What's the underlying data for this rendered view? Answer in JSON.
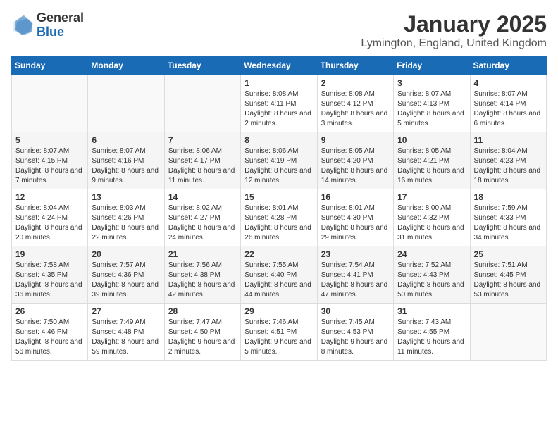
{
  "logo": {
    "general": "General",
    "blue": "Blue"
  },
  "title": "January 2025",
  "location": "Lymington, England, United Kingdom",
  "weekdays": [
    "Sunday",
    "Monday",
    "Tuesday",
    "Wednesday",
    "Thursday",
    "Friday",
    "Saturday"
  ],
  "weeks": [
    [
      {
        "day": "",
        "info": ""
      },
      {
        "day": "",
        "info": ""
      },
      {
        "day": "",
        "info": ""
      },
      {
        "day": "1",
        "info": "Sunrise: 8:08 AM\nSunset: 4:11 PM\nDaylight: 8 hours and 2 minutes."
      },
      {
        "day": "2",
        "info": "Sunrise: 8:08 AM\nSunset: 4:12 PM\nDaylight: 8 hours and 3 minutes."
      },
      {
        "day": "3",
        "info": "Sunrise: 8:07 AM\nSunset: 4:13 PM\nDaylight: 8 hours and 5 minutes."
      },
      {
        "day": "4",
        "info": "Sunrise: 8:07 AM\nSunset: 4:14 PM\nDaylight: 8 hours and 6 minutes."
      }
    ],
    [
      {
        "day": "5",
        "info": "Sunrise: 8:07 AM\nSunset: 4:15 PM\nDaylight: 8 hours and 7 minutes."
      },
      {
        "day": "6",
        "info": "Sunrise: 8:07 AM\nSunset: 4:16 PM\nDaylight: 8 hours and 9 minutes."
      },
      {
        "day": "7",
        "info": "Sunrise: 8:06 AM\nSunset: 4:17 PM\nDaylight: 8 hours and 11 minutes."
      },
      {
        "day": "8",
        "info": "Sunrise: 8:06 AM\nSunset: 4:19 PM\nDaylight: 8 hours and 12 minutes."
      },
      {
        "day": "9",
        "info": "Sunrise: 8:05 AM\nSunset: 4:20 PM\nDaylight: 8 hours and 14 minutes."
      },
      {
        "day": "10",
        "info": "Sunrise: 8:05 AM\nSunset: 4:21 PM\nDaylight: 8 hours and 16 minutes."
      },
      {
        "day": "11",
        "info": "Sunrise: 8:04 AM\nSunset: 4:23 PM\nDaylight: 8 hours and 18 minutes."
      }
    ],
    [
      {
        "day": "12",
        "info": "Sunrise: 8:04 AM\nSunset: 4:24 PM\nDaylight: 8 hours and 20 minutes."
      },
      {
        "day": "13",
        "info": "Sunrise: 8:03 AM\nSunset: 4:26 PM\nDaylight: 8 hours and 22 minutes."
      },
      {
        "day": "14",
        "info": "Sunrise: 8:02 AM\nSunset: 4:27 PM\nDaylight: 8 hours and 24 minutes."
      },
      {
        "day": "15",
        "info": "Sunrise: 8:01 AM\nSunset: 4:28 PM\nDaylight: 8 hours and 26 minutes."
      },
      {
        "day": "16",
        "info": "Sunrise: 8:01 AM\nSunset: 4:30 PM\nDaylight: 8 hours and 29 minutes."
      },
      {
        "day": "17",
        "info": "Sunrise: 8:00 AM\nSunset: 4:32 PM\nDaylight: 8 hours and 31 minutes."
      },
      {
        "day": "18",
        "info": "Sunrise: 7:59 AM\nSunset: 4:33 PM\nDaylight: 8 hours and 34 minutes."
      }
    ],
    [
      {
        "day": "19",
        "info": "Sunrise: 7:58 AM\nSunset: 4:35 PM\nDaylight: 8 hours and 36 minutes."
      },
      {
        "day": "20",
        "info": "Sunrise: 7:57 AM\nSunset: 4:36 PM\nDaylight: 8 hours and 39 minutes."
      },
      {
        "day": "21",
        "info": "Sunrise: 7:56 AM\nSunset: 4:38 PM\nDaylight: 8 hours and 42 minutes."
      },
      {
        "day": "22",
        "info": "Sunrise: 7:55 AM\nSunset: 4:40 PM\nDaylight: 8 hours and 44 minutes."
      },
      {
        "day": "23",
        "info": "Sunrise: 7:54 AM\nSunset: 4:41 PM\nDaylight: 8 hours and 47 minutes."
      },
      {
        "day": "24",
        "info": "Sunrise: 7:52 AM\nSunset: 4:43 PM\nDaylight: 8 hours and 50 minutes."
      },
      {
        "day": "25",
        "info": "Sunrise: 7:51 AM\nSunset: 4:45 PM\nDaylight: 8 hours and 53 minutes."
      }
    ],
    [
      {
        "day": "26",
        "info": "Sunrise: 7:50 AM\nSunset: 4:46 PM\nDaylight: 8 hours and 56 minutes."
      },
      {
        "day": "27",
        "info": "Sunrise: 7:49 AM\nSunset: 4:48 PM\nDaylight: 8 hours and 59 minutes."
      },
      {
        "day": "28",
        "info": "Sunrise: 7:47 AM\nSunset: 4:50 PM\nDaylight: 9 hours and 2 minutes."
      },
      {
        "day": "29",
        "info": "Sunrise: 7:46 AM\nSunset: 4:51 PM\nDaylight: 9 hours and 5 minutes."
      },
      {
        "day": "30",
        "info": "Sunrise: 7:45 AM\nSunset: 4:53 PM\nDaylight: 9 hours and 8 minutes."
      },
      {
        "day": "31",
        "info": "Sunrise: 7:43 AM\nSunset: 4:55 PM\nDaylight: 9 hours and 11 minutes."
      },
      {
        "day": "",
        "info": ""
      }
    ]
  ]
}
